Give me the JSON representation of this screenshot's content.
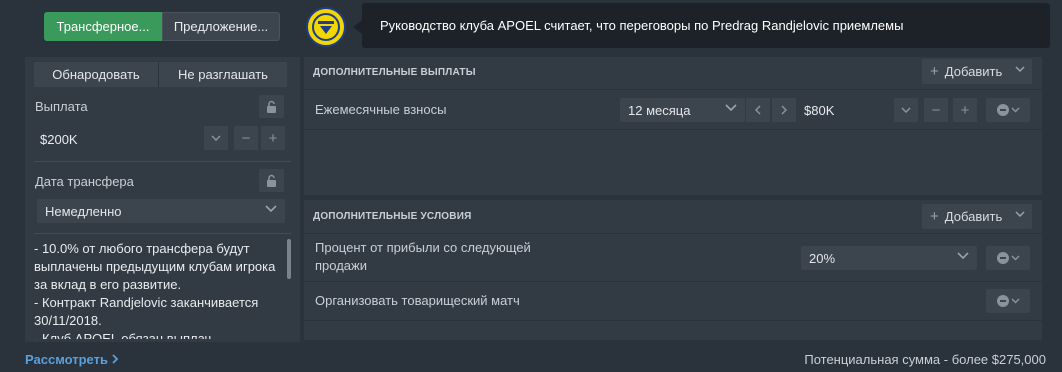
{
  "tabs": [
    {
      "label": "Трансферное..."
    },
    {
      "label": "Предложение..."
    }
  ],
  "message": "Руководство клуба APOEL считает, что переговоры по Predrag Randjelovic приемлемы",
  "left": {
    "publish_label": "Обнародовать",
    "hide_label": "Не разглашать",
    "payment_label": "Выплата",
    "payment_value": "$200K",
    "transfer_date_label": "Дата трансфера",
    "transfer_date_value": "Немедленно",
    "notes": [
      "- 10.0% от любого трансфера будут",
      "выплачены предыдущим клубам игрока",
      "за вклад в его развитие.",
      "- Контракт Randjelovic заканчивается",
      "30/11/2018.",
      "- Клуб APOEL обязан выплач..."
    ]
  },
  "additional_payments": {
    "header": "ДОПОЛНИТЕЛЬНЫЕ ВЫПЛАТЫ",
    "add_label": "Добавить",
    "rows": [
      {
        "label": "Ежемесячные взносы",
        "period": "12 месяца",
        "amount": "$80K"
      }
    ]
  },
  "additional_conditions": {
    "header": "ДОПОЛНИТЕЛЬНЫЕ УСЛОВИЯ",
    "add_label": "Добавить",
    "rows": [
      {
        "label_line1": "Процент от прибыли со следующей",
        "label_line2": "продажи",
        "value": "20%"
      },
      {
        "label": "Организовать товарищеский матч"
      }
    ]
  },
  "footer": {
    "review_label": "Рассмотреть",
    "total": "Потенциальная сумма - более $275,000"
  },
  "colors": {
    "background": "#2a323b",
    "panel": "#323a43",
    "accent_green": "#3a9a5c",
    "link_blue": "#5aa0dc"
  }
}
